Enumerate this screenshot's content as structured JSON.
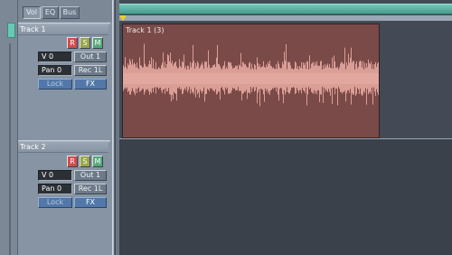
{
  "view_tabs": {
    "vol": "Vol",
    "eq": "EQ",
    "bus": "Bus"
  },
  "tracks": [
    {
      "title": "Track 1",
      "record": "R",
      "solo": "S",
      "mute": "M",
      "volume": "V 0",
      "output": "Out 1",
      "pan": "Pan 0",
      "input": "Rec 1L",
      "lock": "Lock",
      "fx": "FX"
    },
    {
      "title": "Track 2",
      "record": "R",
      "solo": "S",
      "mute": "M",
      "volume": "V 0",
      "output": "Out 1",
      "pan": "Pan 0",
      "input": "Rec 1L",
      "lock": "Lock",
      "fx": "FX"
    }
  ],
  "clip": {
    "title": "Track 1 (3)"
  },
  "colors": {
    "clip_body": "#7a4a48",
    "waveform": "#e6a79e",
    "ruler": "#5fb3a5",
    "record": "#d24c4c",
    "solo": "#9aa64c",
    "mute": "#56a87a",
    "playhead": "#f2d21c"
  }
}
